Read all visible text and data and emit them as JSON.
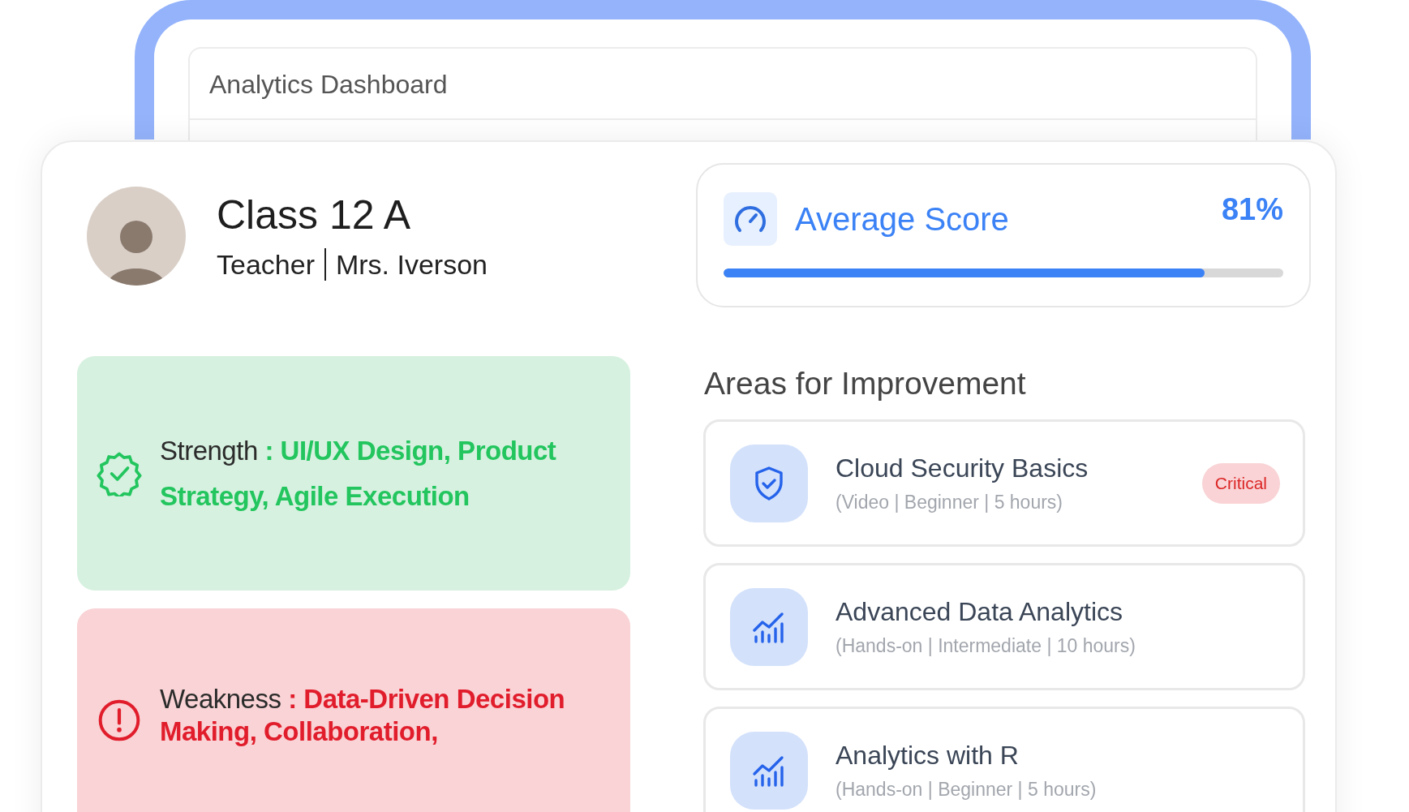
{
  "window": {
    "title": "Analytics Dashboard"
  },
  "class_info": {
    "name": "Class 12 A",
    "role": "Teacher",
    "teacher": "Mrs. Iverson"
  },
  "average_score": {
    "label": "Average Score",
    "value": "81%",
    "level": 0.86
  },
  "insights": [
    {
      "kind": "strength",
      "label": "Strength",
      "details": ": UI/UX Design, Product Strategy, Agile Execution"
    },
    {
      "kind": "weakness",
      "label": "Weakness",
      "details": ": Data-Driven Decision Making, Collaboration,"
    }
  ],
  "improvement": {
    "heading": "Areas for Improvement",
    "courses": [
      {
        "kind": "security",
        "title": "Cloud Security Basics",
        "meta": "(Video | Beginner | 5 hours)",
        "badge": "Critical"
      },
      {
        "kind": "analytics",
        "title": "Advanced Data Analytics",
        "meta": "(Hands-on | Intermediate | 10 hours)"
      },
      {
        "kind": "analytics",
        "title": "Analytics with R",
        "meta": "(Hands-on | Beginner | 5 hours)"
      }
    ]
  }
}
